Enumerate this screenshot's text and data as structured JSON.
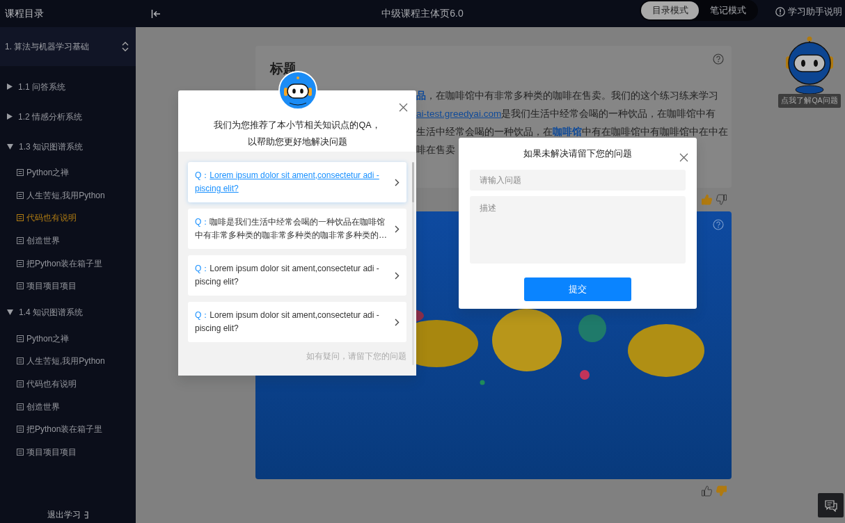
{
  "top_bar": {
    "sidebar_title": "课程目录",
    "page_title": "中级课程主体页6.0",
    "modes": [
      {
        "label": "目录模式",
        "selected": true
      },
      {
        "label": "笔记模式",
        "selected": false
      }
    ],
    "help": "学习助手说明"
  },
  "sidebar": {
    "chapter": "1. 算法与机器学习基础",
    "sections": [
      {
        "label": "1.1 问答系统",
        "expanded": false
      },
      {
        "label": "1.2 情感分析系统",
        "expanded": false
      },
      {
        "label": "1.3 知识图谱系统",
        "expanded": true,
        "children": [
          {
            "label": "Python之禅",
            "selected": false
          },
          {
            "label": "人生苦短,我用Python",
            "selected": false
          },
          {
            "label": "代码也有说明",
            "selected": true
          },
          {
            "label": "创造世界",
            "selected": false
          },
          {
            "label": "把Python装在箱子里",
            "selected": false
          },
          {
            "label": "项目项目项目",
            "selected": false
          }
        ]
      },
      {
        "label": "1.4 知识图谱系统",
        "expanded": true,
        "children": [
          {
            "label": "Python之禅",
            "selected": false
          },
          {
            "label": "人生苦短,我用Python",
            "selected": false
          },
          {
            "label": "代码也有说明",
            "selected": false
          },
          {
            "label": "创造世界",
            "selected": false
          },
          {
            "label": "把Python装在箱子里",
            "selected": false
          },
          {
            "label": "项目项目项目",
            "selected": false
          }
        ]
      }
    ],
    "exit": "退出学习"
  },
  "article": {
    "title": "标题",
    "lines": [
      [
        {
          "kind": "link",
          "text": "品"
        },
        {
          "kind": "text",
          "text": "，在咖啡馆中有非常多种类的咖啡在售卖。我们的这个练习练来学习"
        }
      ],
      [
        {
          "kind": "url",
          "text": "ai-test.greedyai.com"
        },
        {
          "kind": "text",
          "text": "是我们生活中经常会喝的一种饮品，在咖啡馆中有"
        }
      ],
      [
        {
          "kind": "text",
          "text": "生活中经常会喝的一种饮品，在"
        },
        {
          "kind": "link",
          "text": "咖啡馆"
        },
        {
          "kind": "text",
          "text": "中有在咖啡馆中有咖啡馆中在中在"
        }
      ],
      [
        {
          "kind": "text",
          "text": "啡在售卖"
        }
      ]
    ],
    "feedback": {
      "liked": true,
      "disliked": false
    }
  },
  "video": {
    "kind": "picture",
    "feedback": {
      "liked": false,
      "disliked": true
    }
  },
  "assistant": {
    "tooltip": "点我了解QA问题"
  },
  "qa_dialog": {
    "heading": [
      "我们为您推荐了本小节相关知识点的QA，",
      "以帮助您更好地解决问题"
    ],
    "items": [
      {
        "prefix": "Q：",
        "text": "Lorem ipsum dolor sit ament,consectetur adi -piscing elit?",
        "selected": true
      },
      {
        "prefix": "Q：",
        "text": "咖啡是我们生活中经常会喝的一种饮品在咖啡馆中有非常多种类的咖非常多种类的咖非常多种类的…",
        "selected": false
      },
      {
        "prefix": "Q：",
        "text": "Lorem ipsum dolor sit ament,consectetur adi -piscing elit?",
        "selected": false
      },
      {
        "prefix": "Q：",
        "text": "Lorem ipsum dolor sit ament,consectetur adi -piscing elit?",
        "selected": false
      }
    ],
    "footer": "如有疑问，请留下您的问题"
  },
  "question_dialog": {
    "title": "如果未解决请留下您的问题",
    "question_placeholder": "请输入问题",
    "description_placeholder": "描述",
    "submit": "提交"
  }
}
